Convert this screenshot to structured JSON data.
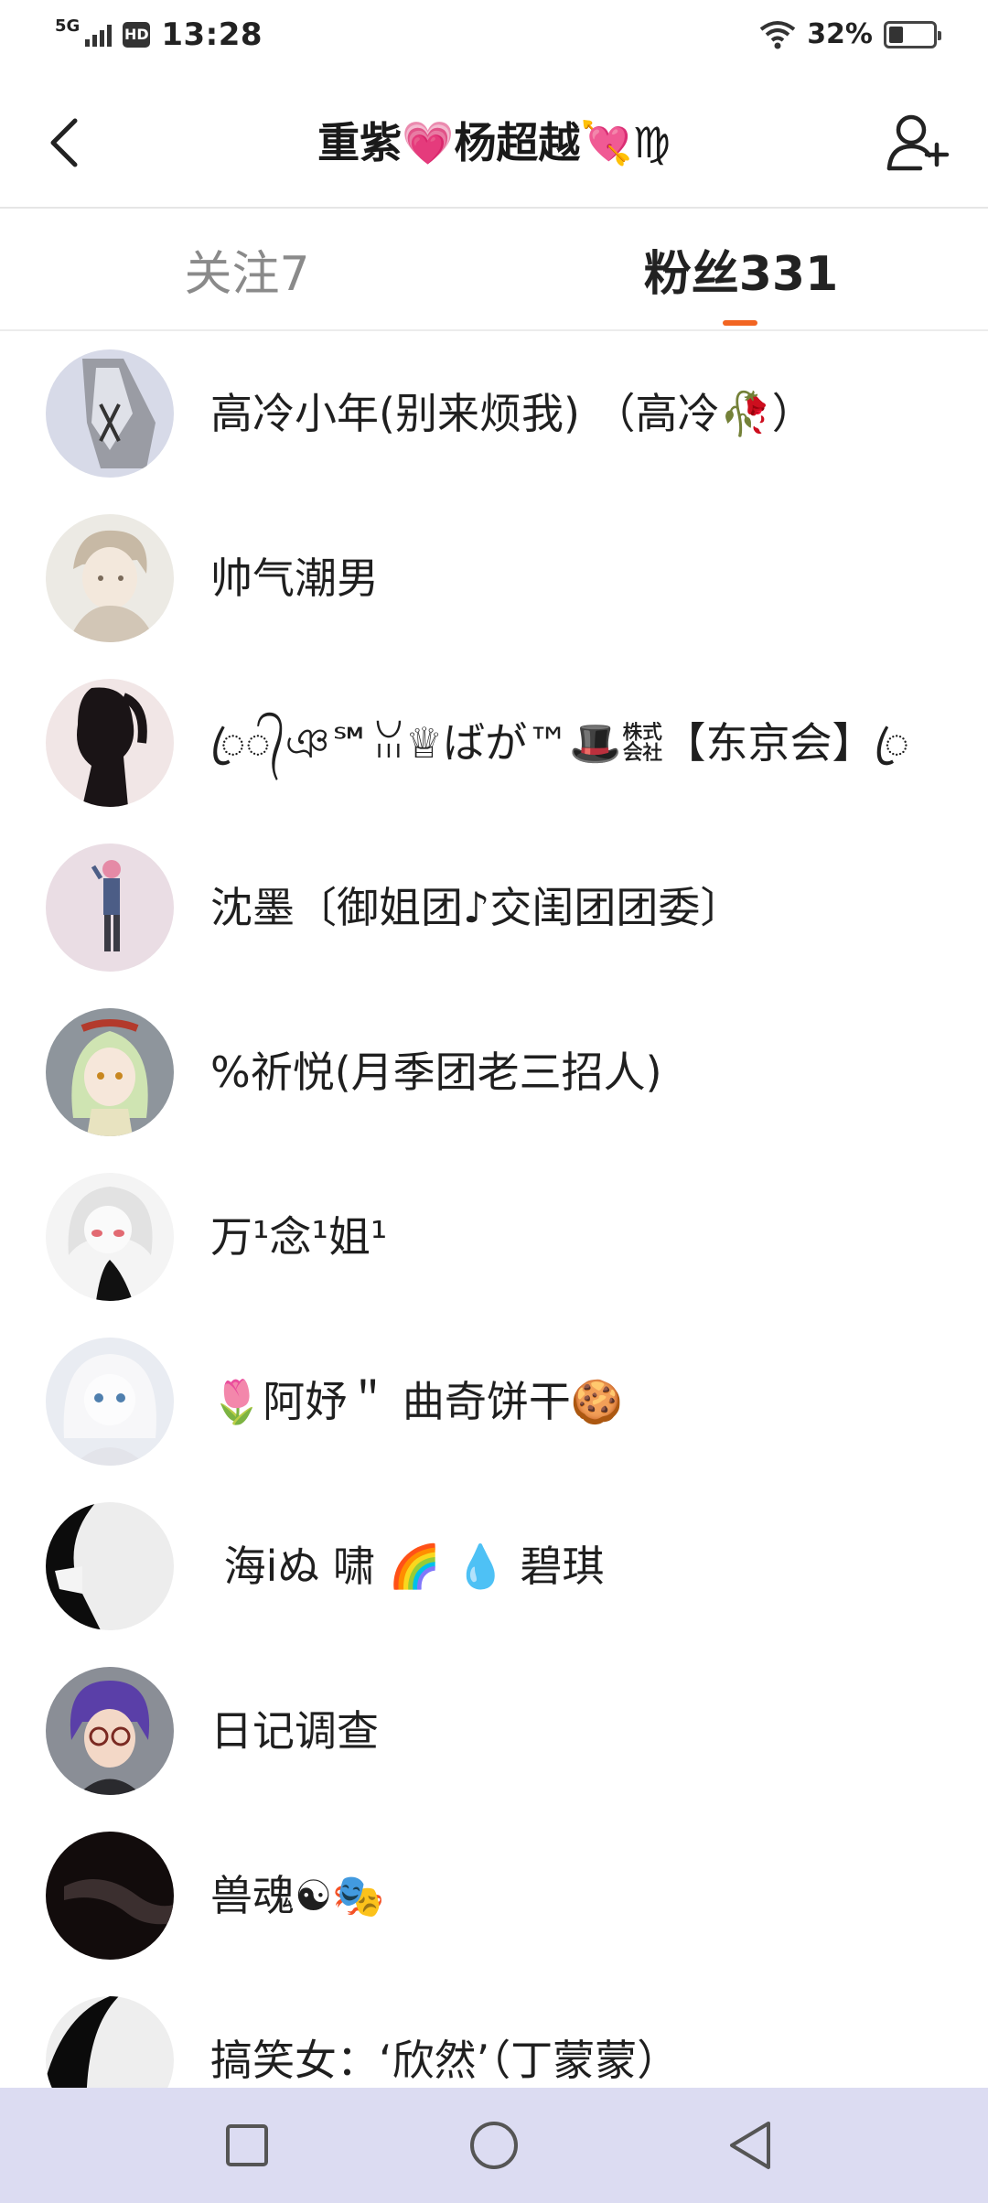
{
  "status_bar": {
    "network": "5G",
    "hd": "HD",
    "time": "13:28",
    "battery": "32%",
    "battery_level": 0.32
  },
  "header": {
    "title": "重紫💗杨超越💘♍"
  },
  "tabs": {
    "following": "关注7",
    "followers": "粉丝331",
    "active": "followers",
    "accent_color": "#f26522"
  },
  "followers": [
    {
      "name": "高冷小年(别来烦我) （高冷🥀）",
      "avatar": "silver-robot"
    },
    {
      "name": "帅气潮男",
      "avatar": "beige-anime-boy"
    },
    {
      "name": "ꦿ᭄ঞ℠ꈍ♕ばが™🎩㍿【东京会】ꦿ",
      "avatar": "black-silhouette-girl"
    },
    {
      "name": "沈墨〔御姐团♪交闺团团委〕",
      "avatar": "pink-hair-figure"
    },
    {
      "name": "%祈悦(月季团老三招人)",
      "avatar": "green-hair-girl"
    },
    {
      "name": "万¹念¹姐¹",
      "avatar": "white-hair-girl"
    },
    {
      "name": "🌷阿妤＂ 曲奇饼干🍪",
      "avatar": "white-blue-eyes-girl"
    },
    {
      "name": "ึ 海iぬ 啸 🌈 💧 碧琪",
      "avatar": "monochrome-profile"
    },
    {
      "name": "日记调查",
      "avatar": "purple-hair-glasses-boy"
    },
    {
      "name": "兽魂☯🎭",
      "avatar": "dark-abstract"
    },
    {
      "name": "搞笑女：‘欣然’（丁蒙蒙）",
      "avatar": "black-white-shape"
    }
  ]
}
